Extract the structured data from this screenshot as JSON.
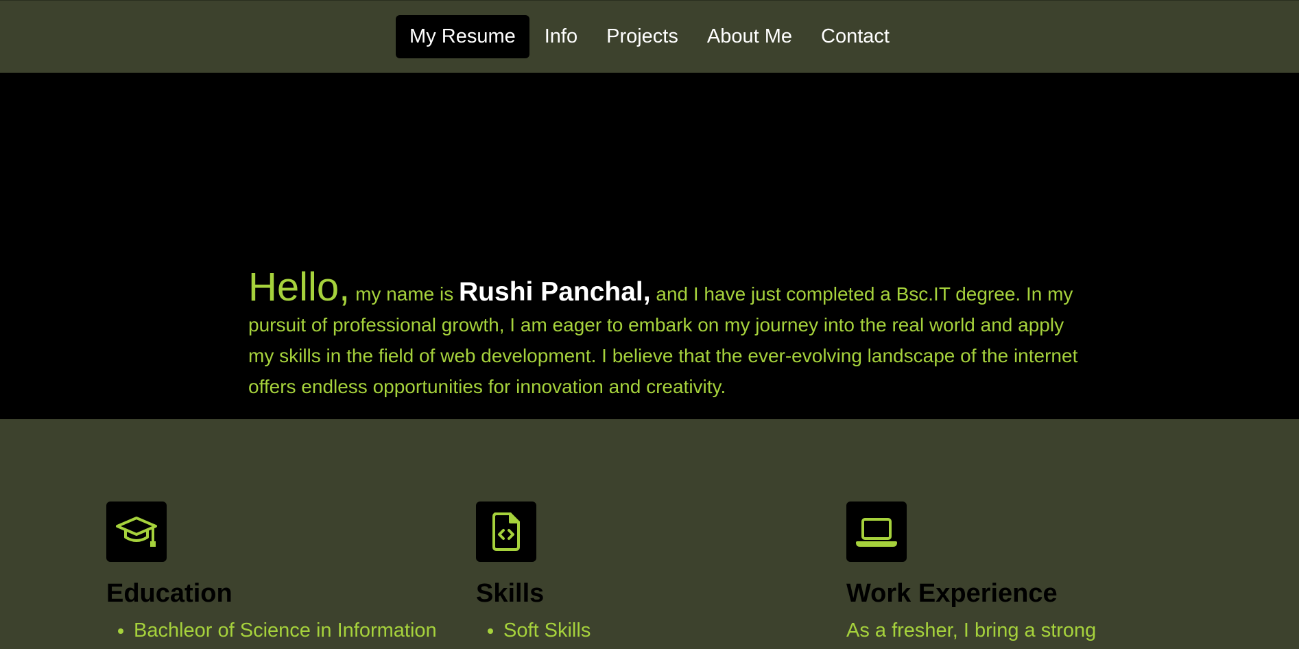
{
  "nav": {
    "items": [
      {
        "label": "My Resume",
        "active": true
      },
      {
        "label": "Info",
        "active": false
      },
      {
        "label": "Projects",
        "active": false
      },
      {
        "label": "About Me",
        "active": false
      },
      {
        "label": "Contact",
        "active": false
      }
    ]
  },
  "hero": {
    "greeting": "Hello,",
    "intro": "my name is",
    "name": "Rushi Panchal,",
    "body": "and I have just completed a Bsc.IT degree. In my pursuit of professional growth, I am eager to embark on my journey into the real world and apply my skills in the field of web development. I believe that the ever-evolving landscape of the internet offers endless opportunities for innovation and creativity."
  },
  "features": {
    "education": {
      "icon": "graduation-cap-icon",
      "title": "Education",
      "items": [
        "Bachleor of Science in Information"
      ]
    },
    "skills": {
      "icon": "code-file-icon",
      "title": "Skills",
      "items": [
        "Soft Skills"
      ]
    },
    "work": {
      "icon": "laptop-icon",
      "title": "Work Experience",
      "text": "As a fresher, I bring a strong"
    }
  },
  "colors": {
    "accent": "#a6d23c",
    "nav_bg": "#3d422d",
    "hero_bg": "#000000",
    "text_white": "#ffffff"
  }
}
